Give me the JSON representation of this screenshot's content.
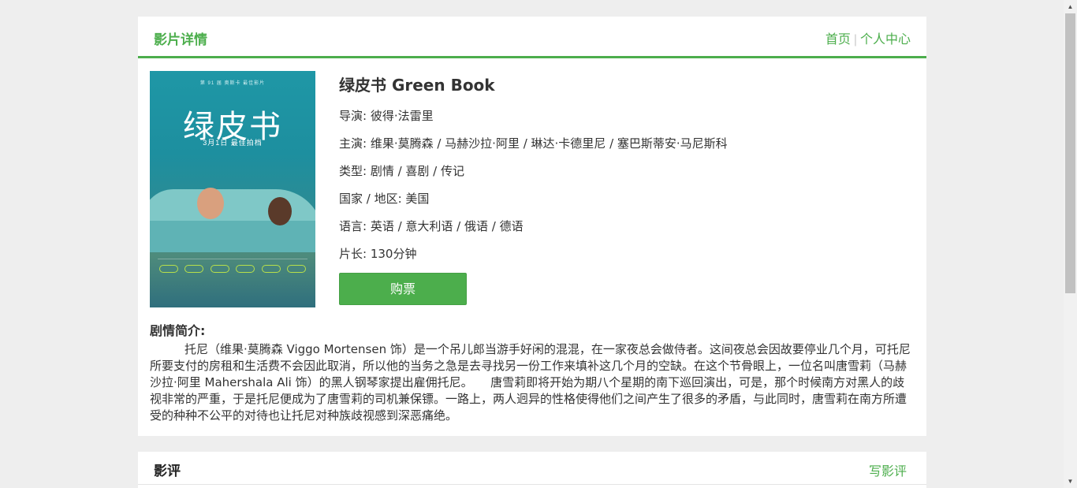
{
  "detail": {
    "title": "影片详情",
    "nav": {
      "home": "首页",
      "separator": "|",
      "profile": "个人中心"
    }
  },
  "poster": {
    "top_text": "第 91 届 奥斯卡 最佳影片",
    "title": "绿皮书",
    "date": "3月1日 最佳拍档"
  },
  "movie": {
    "title": "绿皮书 Green Book",
    "director": "导演: 彼得·法雷里",
    "cast": "主演: 维果·莫腾森 / 马赫沙拉·阿里 / 琳达·卡德里尼 / 塞巴斯蒂安·马尼斯科",
    "genre": "类型: 剧情 / 喜剧 / 传记",
    "region": "国家 / 地区: 美国",
    "language": "语言: 英语 / 意大利语 / 俄语 / 德语",
    "runtime": "片长: 130分钟",
    "buy_label": "购票"
  },
  "synopsis": {
    "label": "剧情简介:",
    "text": "托尼（维果·莫腾森 Viggo Mortensen 饰）是一个吊儿郎当游手好闲的混混，在一家夜总会做侍者。这间夜总会因故要停业几个月，可托尼所要支付的房租和生活费不会因此取消，所以他的当务之急是去寻找另一份工作来填补这几个月的空缺。在这个节骨眼上，一位名叫唐雪莉（马赫沙拉·阿里 Mahershala Ali 饰）的黑人钢琴家提出雇佣托尼。　　唐雪莉即将开始为期八个星期的南下巡回演出，可是，那个时候南方对黑人的歧视非常的严重，于是托尼便成为了唐雪莉的司机兼保镖。一路上，两人迥异的性格使得他们之间产生了很多的矛盾，与此同时，唐雪莉在南方所遭受的种种不公平的对待也让托尼对种族歧视感到深恶痛绝。"
  },
  "review": {
    "title": "影评",
    "write_label": "写影评"
  },
  "colors": {
    "accent": "#4cae4c",
    "background": "#eeeeee"
  }
}
